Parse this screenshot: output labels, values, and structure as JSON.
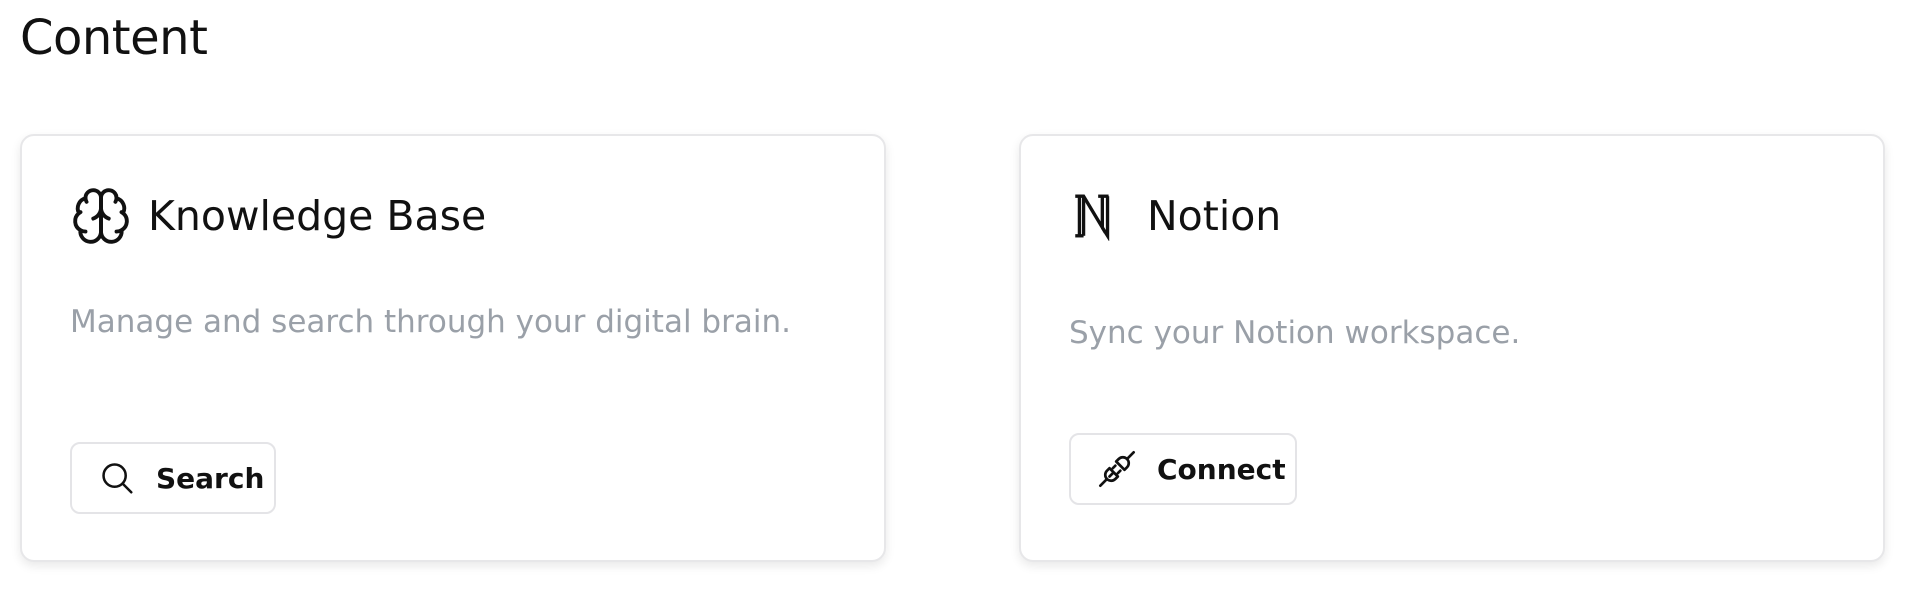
{
  "page": {
    "title": "Content"
  },
  "cards": {
    "knowledge_base": {
      "icon": "brain-icon",
      "title": "Knowledge Base",
      "description": "Manage and search through your digital brain.",
      "button_icon": "search-icon",
      "button_label": "Search"
    },
    "notion": {
      "icon": "notion-logo-icon",
      "title": "Notion",
      "description": "Sync your Notion workspace.",
      "button_icon": "plug-connect-icon",
      "button_label": "Connect"
    }
  },
  "colors": {
    "text": "#111111",
    "muted": "#9aa0a8",
    "border": "#e7e7e9",
    "background": "#ffffff"
  }
}
